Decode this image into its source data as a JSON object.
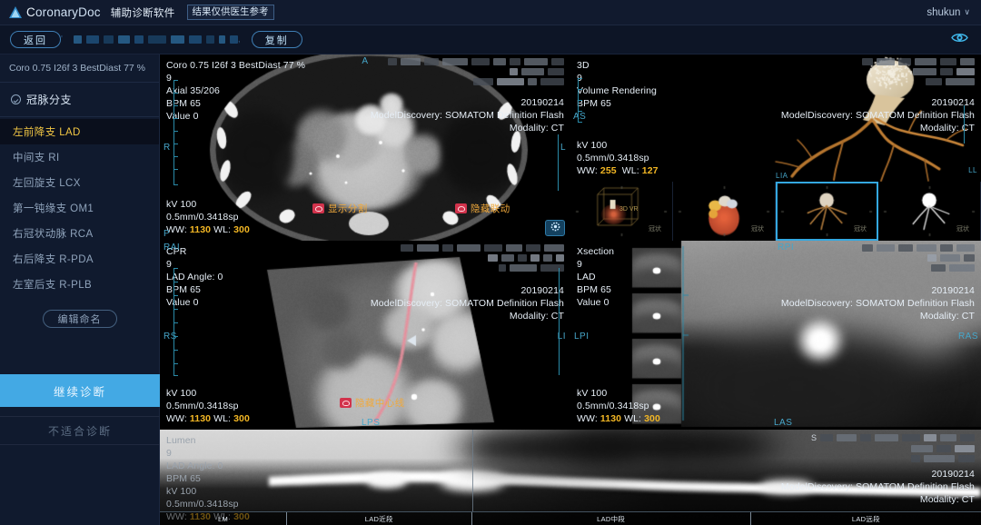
{
  "header": {
    "logo_text_a": "C",
    "logo_text_b": "oronaryDoc",
    "subtitle": "辅助诊断软件",
    "disclaimer": "结果仅供医生参考",
    "user": "shukun",
    "user_caret": "∨",
    "logo_icon": "triangle-logo-icon",
    "eye_icon": "eye-icon"
  },
  "toolbar": {
    "back_label": "返回",
    "copy_label": "复制",
    "redacted_widths": [
      9,
      14,
      11,
      13,
      10,
      20,
      15,
      14,
      9,
      7,
      9
    ],
    "separator_a": "'",
    "separator_b": ","
  },
  "sidebar": {
    "study_line": "Coro 0.75 I26f 3 BestDiast 77 %",
    "section_title": "冠脉分支",
    "section_icon": "check-circle-icon",
    "branches": [
      {
        "label": "左前降支 LAD",
        "active": true
      },
      {
        "label": "中间支 RI",
        "active": false
      },
      {
        "label": "左回旋支 LCX",
        "active": false
      },
      {
        "label": "第一钝缘支 OM1",
        "active": false
      },
      {
        "label": "右冠状动脉 RCA",
        "active": false
      },
      {
        "label": "右后降支 R-PDA",
        "active": false
      },
      {
        "label": "左室后支 R-PLB",
        "active": false
      }
    ],
    "edit_name_label": "编辑命名",
    "cta_primary": "继续诊断",
    "cta_secondary": "不适合诊断"
  },
  "common": {
    "date": "20190214",
    "model_line": "ModelDiscovery: SOMATOM Definition Flash",
    "modality_line": "Modality: CT",
    "kv": "kV 100",
    "spacing": "0.5mm/0.3418sp",
    "ww_label": "WW:",
    "wl_label": "WL:"
  },
  "viewports": {
    "axial": {
      "title": "Coro 0.75 I26f 3 BestDiast 77 %",
      "series": "9",
      "slice": "Axial 35/206",
      "bpm": "BPM 65",
      "value": "Value 0",
      "kv": "kV 100",
      "spacing": "0.5mm/0.3418sp",
      "ww": "1130",
      "wl": "300",
      "markers": {
        "top": "A",
        "left": "R",
        "bottom": "P",
        "right": "L"
      },
      "chip_left": "显示分割",
      "chip_right": "隐藏联动",
      "gear_icon": "gear-icon"
    },
    "vr3d": {
      "title": "3D",
      "series": "9",
      "mode": "Volume Rendering",
      "bpm": "BPM 65",
      "kv": "kV 100",
      "spacing": "0.5mm/0.3418sp",
      "ww": "255",
      "wl": "127",
      "markers": {
        "left": "AS",
        "bottom": "LIA",
        "right": "LL"
      }
    },
    "thumbnails": [
      {
        "label": "3D VR",
        "corner": "冠状",
        "selected": false,
        "kind": "box-vr"
      },
      {
        "label": "",
        "corner": "冠状",
        "selected": false,
        "kind": "heart-color"
      },
      {
        "label": "",
        "corner": "冠状",
        "selected": true,
        "kind": "vessel-tan"
      },
      {
        "label": "",
        "corner": "冠状",
        "selected": false,
        "kind": "vessel-white"
      }
    ],
    "cpr": {
      "title": "CPR",
      "series": "9",
      "angle": "LAD Angle: 0",
      "bpm": "BPM 65",
      "value": "Value 0",
      "kv": "kV 100",
      "spacing": "0.5mm/0.3418sp",
      "ww": "1130",
      "wl": "300",
      "markers": {
        "top": "RAI",
        "left": "RS",
        "bottom": "LPS",
        "right": "LI"
      },
      "chip": "隐藏中心线"
    },
    "xsection": {
      "title": "Xsection",
      "series": "9",
      "vessel": "LAD",
      "bpm": "BPM 65",
      "value": "Value 0",
      "kv": "kV 100",
      "spacing": "0.5mm/0.3418sp",
      "ww": "1130",
      "wl": "300",
      "markers": {
        "left": "LPI",
        "top": "RPI",
        "bottom": "LAS",
        "right": "RAS"
      }
    },
    "lumen": {
      "title": "Lumen",
      "series": "9",
      "angle": "LAD Angle: 0",
      "bpm": "BPM 65",
      "kv": "kV 100",
      "spacing": "0.5mm/0.3418sp",
      "ww": "1130",
      "wl": "300",
      "segments": [
        "LM",
        "LAD近段",
        "LAD中段",
        "LAD远段"
      ],
      "marker_right": "S"
    }
  },
  "colors": {
    "accent": "#43a9e4",
    "highlight_yellow": "#f2c744",
    "annotation_orange": "#f0a93c",
    "ww_gold": "#f3b724",
    "marker_cyan": "#46a6c9",
    "panel_bg": "#101a2e",
    "app_bg": "#0a0f1e"
  }
}
